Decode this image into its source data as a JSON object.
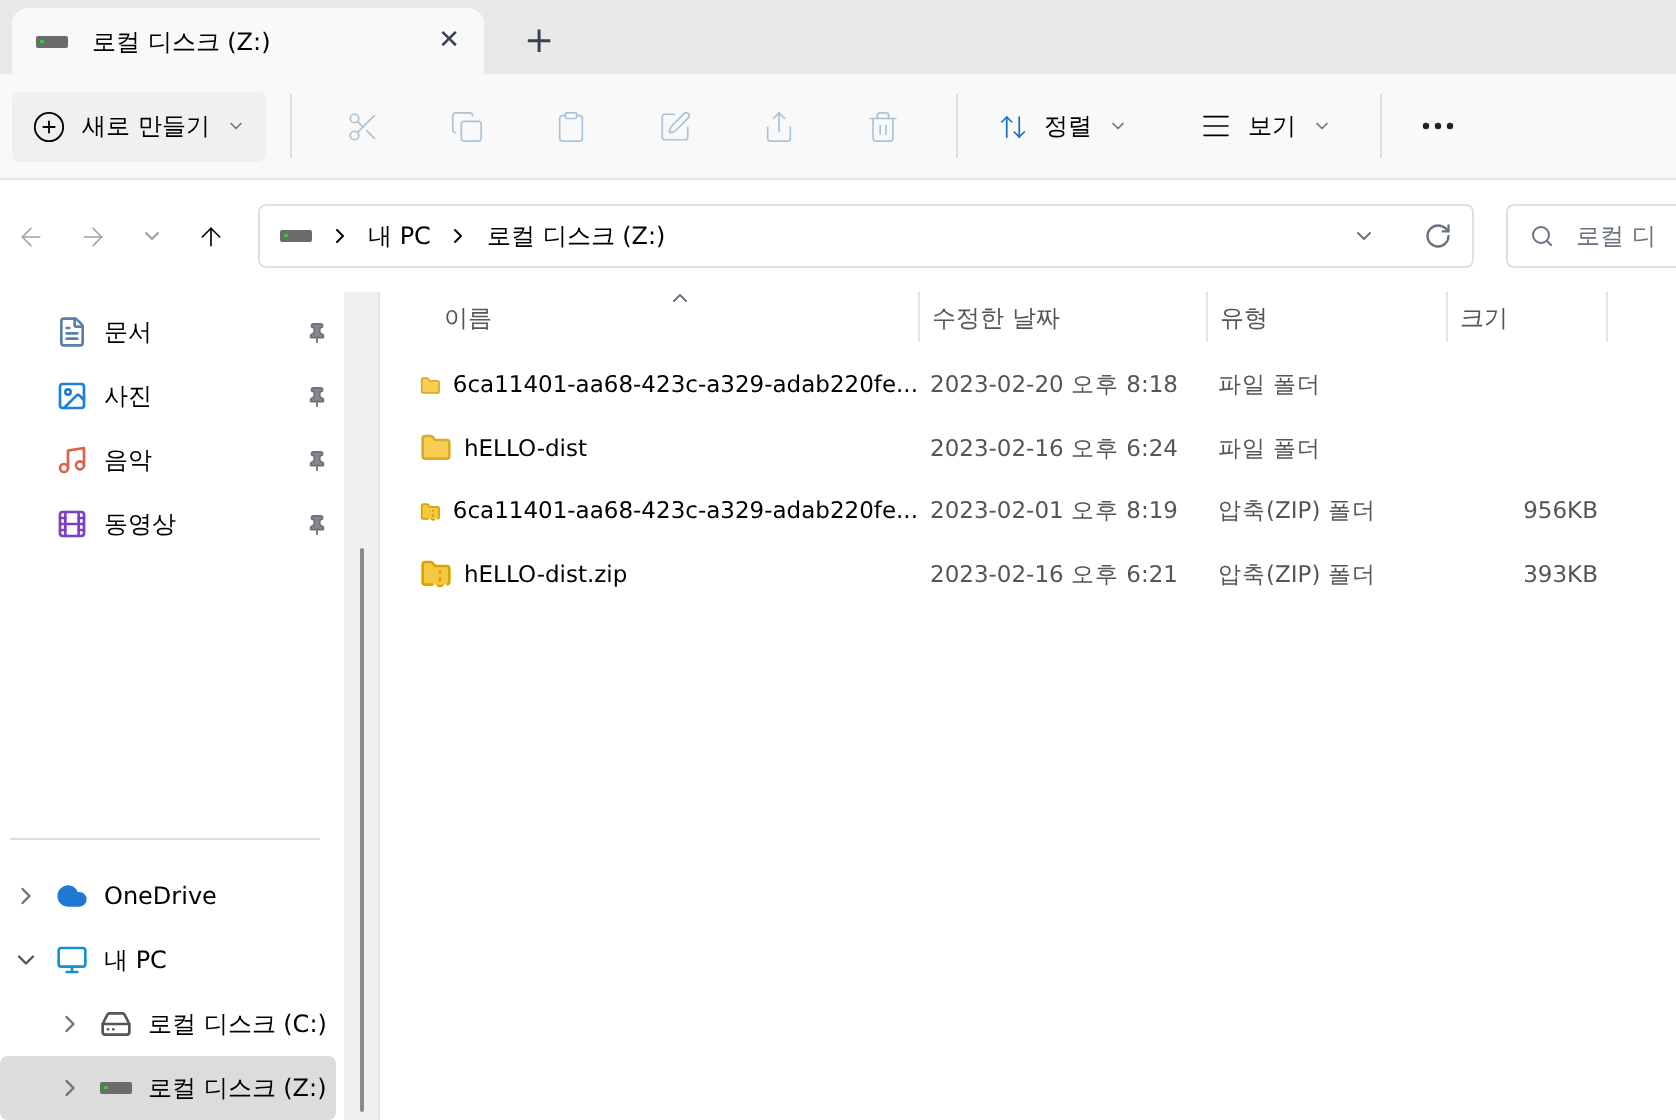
{
  "tabs": [
    {
      "label": "로컬 디스크 (Z:)",
      "selected": true,
      "close": "✕"
    }
  ],
  "new_tab": "+",
  "toolbar": {
    "new": {
      "label": "새로 만들기"
    },
    "actions": [
      {
        "kind": "cut",
        "disabled": true
      },
      {
        "kind": "copy",
        "disabled": true
      },
      {
        "kind": "paste",
        "disabled": true
      },
      {
        "kind": "rename",
        "disabled": true
      },
      {
        "kind": "share",
        "disabled": true
      },
      {
        "kind": "delete",
        "disabled": true
      }
    ],
    "sort": {
      "label": "정렬"
    },
    "view": {
      "label": "보기"
    }
  },
  "address_bar": {
    "path": [
      "내 PC",
      "로컬 디스크 (Z:)"
    ]
  },
  "search": {
    "placeholder": "로컬 디"
  },
  "sidebar": {
    "quick_access": [
      {
        "label": "문서",
        "kind": "documents",
        "pinned": true
      },
      {
        "label": "사진",
        "kind": "pictures",
        "pinned": true
      },
      {
        "label": "음악",
        "kind": "music",
        "pinned": true
      },
      {
        "label": "동영상",
        "kind": "videos",
        "pinned": true
      }
    ],
    "tree": [
      {
        "label": "OneDrive",
        "kind": "cloud",
        "expanded": false,
        "selected": false
      },
      {
        "label": "내 PC",
        "kind": "pc",
        "expanded": true,
        "selected": false,
        "children": [
          {
            "label": "로컬 디스크 (C:)",
            "kind": "system-drive",
            "expanded": false,
            "selected": false
          },
          {
            "label": "로컬 디스크 (Z:)",
            "kind": "drive",
            "expanded": false,
            "selected": true
          }
        ]
      }
    ]
  },
  "table": {
    "columns": [
      "이름",
      "수정한 날짜",
      "유형",
      "크기"
    ],
    "rows": [
      {
        "kind": "folder",
        "name": "6ca11401-aa68-423c-a329-adab220fe...",
        "date": "2023-02-20 오후 8:18",
        "type": "파일 폴더",
        "size": ""
      },
      {
        "kind": "folder",
        "name": "hELLO-dist",
        "date": "2023-02-16 오후 6:24",
        "type": "파일 폴더",
        "size": ""
      },
      {
        "kind": "zip",
        "name": "6ca11401-aa68-423c-a329-adab220fe...",
        "date": "2023-02-01 오후 8:19",
        "type": "압축(ZIP) 폴더",
        "size": "956KB"
      },
      {
        "kind": "zip",
        "name": "hELLO-dist.zip",
        "date": "2023-02-16 오후 6:21",
        "type": "압축(ZIP) 폴더",
        "size": "393KB"
      }
    ]
  }
}
